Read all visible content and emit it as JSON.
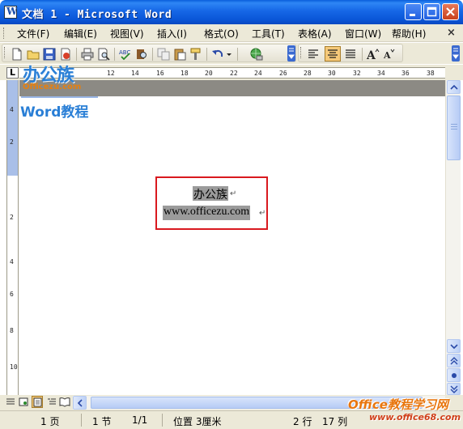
{
  "window": {
    "title": "文档 1 - Microsoft Word"
  },
  "menu": {
    "items": [
      {
        "label": "文件(F)"
      },
      {
        "label": "编辑(E)"
      },
      {
        "label": "视图(V)"
      },
      {
        "label": "插入(I)"
      },
      {
        "label": "格式(O)"
      },
      {
        "label": "工具(T)"
      },
      {
        "label": "表格(A)"
      },
      {
        "label": "窗口(W)"
      },
      {
        "label": "帮助(H)"
      }
    ]
  },
  "ruler": {
    "ticks": [
      "12",
      "14",
      "16",
      "18",
      "20",
      "22",
      "24",
      "26",
      "28",
      "30",
      "32",
      "34",
      "36",
      "38"
    ],
    "vticks": [
      "4",
      "2",
      "",
      "2",
      "4",
      "6",
      "8",
      "10"
    ]
  },
  "logo": {
    "main": "办公族",
    "url": "Officezu.com",
    "sub": "Word教程"
  },
  "document": {
    "line1": "办公族",
    "line2": "www.officezu.com",
    "para_mark": "↵"
  },
  "status": {
    "page": "1 页",
    "section": "1 节",
    "page_of": "1/1",
    "position": "位置 3厘米",
    "line": "2 行",
    "column": "17 列"
  },
  "watermark": {
    "title": "Office教程学习网",
    "url": "www.office68.com"
  },
  "colors": {
    "titlebar": "#0a5fdc",
    "selection_box": "#d9191f",
    "highlight": "#9b9b9b",
    "accent": "#2a7fd6"
  }
}
